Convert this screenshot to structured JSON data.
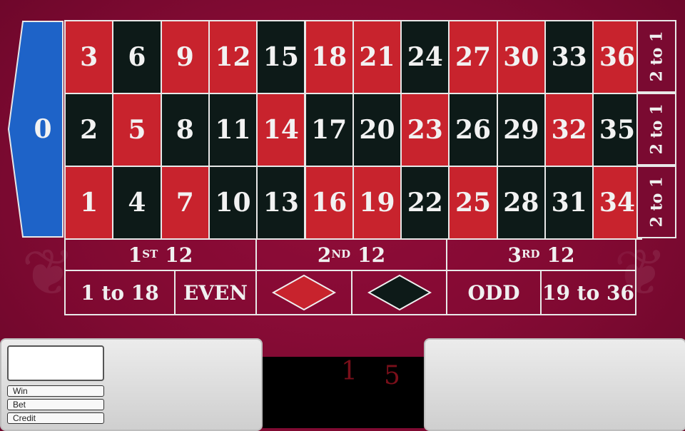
{
  "zero": {
    "label": "0",
    "color": "#1e63c8"
  },
  "grid": {
    "top_row": [
      {
        "n": "3",
        "c": "red"
      },
      {
        "n": "6",
        "c": "black"
      },
      {
        "n": "9",
        "c": "red"
      },
      {
        "n": "12",
        "c": "red"
      },
      {
        "n": "15",
        "c": "black"
      },
      {
        "n": "18",
        "c": "red"
      },
      {
        "n": "21",
        "c": "red"
      },
      {
        "n": "24",
        "c": "black"
      },
      {
        "n": "27",
        "c": "red"
      },
      {
        "n": "30",
        "c": "red"
      },
      {
        "n": "33",
        "c": "black"
      },
      {
        "n": "36",
        "c": "red"
      }
    ],
    "middle_row": [
      {
        "n": "2",
        "c": "black"
      },
      {
        "n": "5",
        "c": "red"
      },
      {
        "n": "8",
        "c": "black"
      },
      {
        "n": "11",
        "c": "black"
      },
      {
        "n": "14",
        "c": "red"
      },
      {
        "n": "17",
        "c": "black"
      },
      {
        "n": "20",
        "c": "black"
      },
      {
        "n": "23",
        "c": "red"
      },
      {
        "n": "26",
        "c": "black"
      },
      {
        "n": "29",
        "c": "black"
      },
      {
        "n": "32",
        "c": "red"
      },
      {
        "n": "35",
        "c": "black"
      }
    ],
    "bottom_row": [
      {
        "n": "1",
        "c": "red"
      },
      {
        "n": "4",
        "c": "black"
      },
      {
        "n": "7",
        "c": "red"
      },
      {
        "n": "10",
        "c": "black"
      },
      {
        "n": "13",
        "c": "black"
      },
      {
        "n": "16",
        "c": "red"
      },
      {
        "n": "19",
        "c": "red"
      },
      {
        "n": "22",
        "c": "black"
      },
      {
        "n": "25",
        "c": "red"
      },
      {
        "n": "28",
        "c": "black"
      },
      {
        "n": "31",
        "c": "black"
      },
      {
        "n": "34",
        "c": "red"
      }
    ]
  },
  "column_bets": [
    "2 to 1",
    "2 to 1",
    "2 to 1"
  ],
  "dozens": [
    {
      "ord": "1",
      "sup": "ST",
      "num": "12"
    },
    {
      "ord": "2",
      "sup": "ND",
      "num": "12"
    },
    {
      "ord": "3",
      "sup": "RD",
      "num": "12"
    }
  ],
  "outside": {
    "low": "1 to 18",
    "even": "EVEN",
    "odd": "ODD",
    "high": "19 to 36"
  },
  "colors": {
    "red": "#c8232d",
    "black": "#0d1a18",
    "felt": "#7f0a32"
  },
  "stats": {
    "win": "Win",
    "bet": "Bet",
    "credit": "Credit"
  },
  "ticker": [
    "1",
    "5"
  ]
}
